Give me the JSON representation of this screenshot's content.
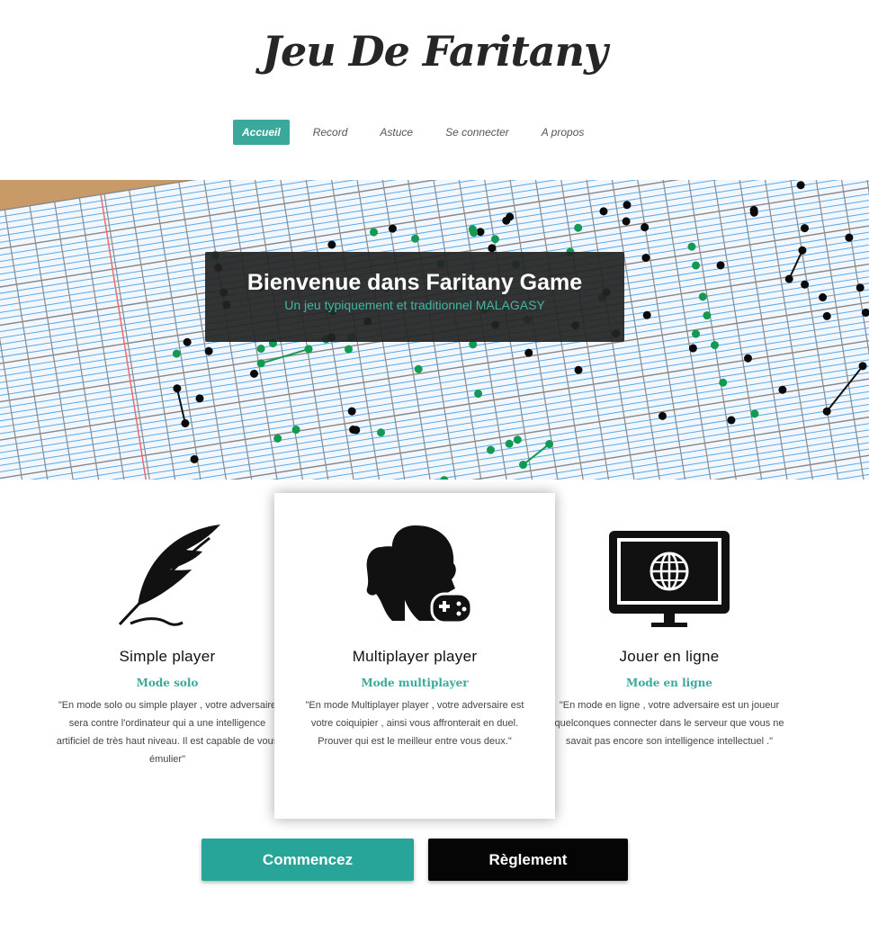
{
  "header": {
    "logo_text": "Jeu De Faritany"
  },
  "nav": {
    "items": [
      {
        "label": "Accueil",
        "active": true
      },
      {
        "label": "Record"
      },
      {
        "label": "Astuce"
      },
      {
        "label": "Se connecter"
      },
      {
        "label": "A propos"
      }
    ]
  },
  "hero": {
    "title": "Bienvenue dans Faritany Game",
    "subtitle": "Un jeu typiquement et traditionnel MALAGASY"
  },
  "features": [
    {
      "icon": "feather-icon",
      "title": "Simple player",
      "mode": "Mode solo",
      "description": "\"En mode solo ou simple player , votre adversaire sera contre l'ordinateur qui a une intelligence artificiel de très haut niveau. Il est capable de vous émulier\""
    },
    {
      "icon": "multiplayer-gamepad-icon",
      "title": "Multiplayer player",
      "mode": "Mode multiplayer",
      "description": "\"En mode Multiplayer player , votre adversaire est votre coiquipier , ainsi vous affronterait en duel. Prouver qui est le meilleur entre vous deux.\""
    },
    {
      "icon": "monitor-globe-icon",
      "title": "Jouer en ligne",
      "mode": "Mode en ligne",
      "description": "\"En mode en ligne , votre adversaire est un joueur quelconques connecter dans le serveur que vous ne savait pas encore son intelligence intellectuel .\""
    }
  ],
  "buttons": {
    "start_label": "Commencez",
    "rules_label": "Règlement"
  },
  "colors": {
    "accent": "#3aa99b",
    "dark": "#050505"
  }
}
